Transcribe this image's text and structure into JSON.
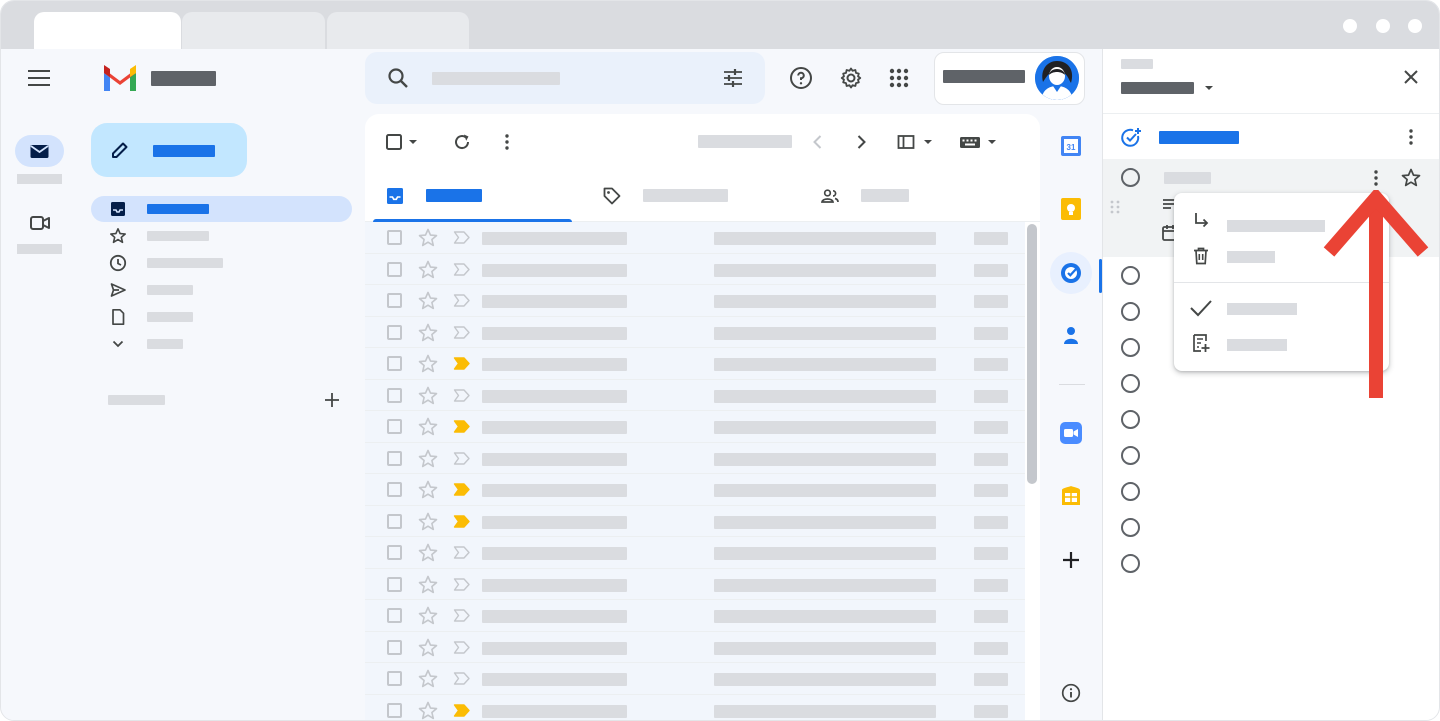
{
  "colors": {
    "accent_blue": "#1a73e8",
    "compose_bg": "#c2e7ff",
    "active_nav_bg": "#d3e3fd",
    "placeholder_gray": "#dadce0",
    "arrow_red": "#ea4335",
    "important_yellow": "#fbbc04"
  },
  "icons": {
    "rail": [
      "hamburger-icon",
      "mail-icon",
      "video-icon"
    ],
    "sidebar": [
      "pencil-icon",
      "inbox-icon",
      "star-icon",
      "clock-icon",
      "send-icon",
      "draft-icon",
      "chevron-down-icon",
      "plus-icon"
    ],
    "top": [
      "search-icon",
      "filter-sliders-icon",
      "help-icon",
      "gear-icon",
      "apps-grid-icon",
      "avatar"
    ],
    "toolbar": [
      "checkbox-icon",
      "refresh-icon",
      "more-vert-icon",
      "chevron-left-icon",
      "chevron-right-icon",
      "split-view-icon",
      "keyboard-icon"
    ],
    "tabs": [
      "inbox-icon",
      "tag-icon",
      "people-icon"
    ],
    "strip": [
      "calendar-icon",
      "keep-icon",
      "tasks-icon",
      "contacts-icon",
      "zoom-icon",
      "slides-icon",
      "plus-icon",
      "info-icon"
    ],
    "tasks_panel": [
      "close-icon",
      "add-task-icon",
      "more-vert-icon",
      "star-icon"
    ],
    "menu": [
      "indent-icon",
      "trash-icon",
      "check-icon",
      "add-note-icon"
    ]
  },
  "mail_rows": [
    {
      "important": false
    },
    {
      "important": false
    },
    {
      "important": false
    },
    {
      "important": false
    },
    {
      "important": true
    },
    {
      "important": false
    },
    {
      "important": true
    },
    {
      "important": false
    },
    {
      "important": true
    },
    {
      "important": true
    },
    {
      "important": false
    },
    {
      "important": false
    },
    {
      "important": false
    },
    {
      "important": false
    },
    {
      "important": false
    },
    {
      "important": true
    }
  ],
  "task_count": 9
}
